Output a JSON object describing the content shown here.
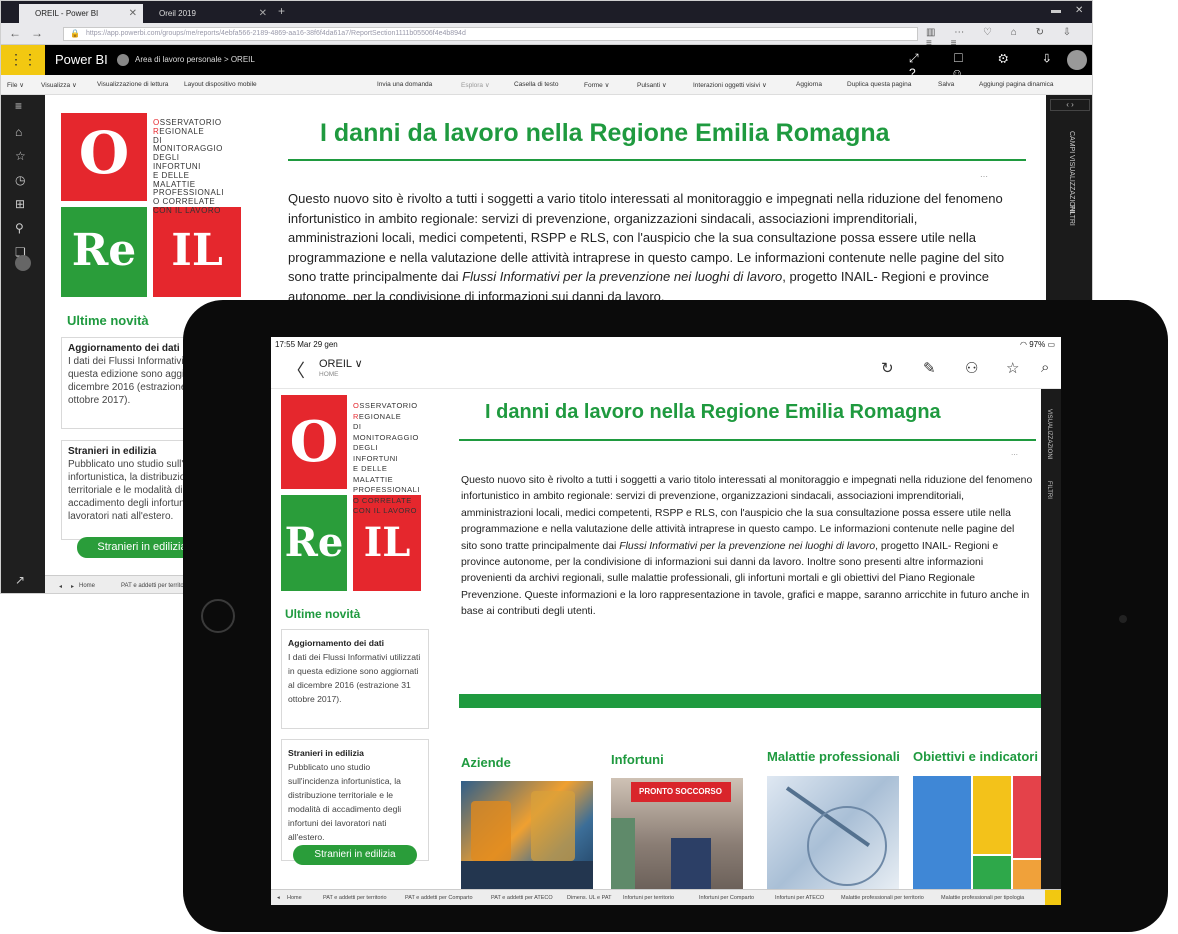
{
  "browser": {
    "tabs": [
      {
        "label": "OREIL - Power BI",
        "close": "✕"
      },
      {
        "label": "Oreil 2019",
        "close": "✕"
      }
    ],
    "new_tab": "+",
    "url": "https://app.powerbi.com/groups/me/reports/4ebfa566-2189-4869-aa16-38f6f4da61a7/ReportSection1111b05506f4e4b894d",
    "toolbar_icons": "▥ ⋯ ♡ ⌂ ↻ ⇩ ≡ ≡"
  },
  "powerbi": {
    "app_name": "Power BI",
    "breadcrumb": "Area di lavoro personale  >  OREIL",
    "header_icons": "⤢ ☐ ⚙ ⇩ ? ☺",
    "ribbon": {
      "file": "File ∨",
      "visualizza": "Visualizza ∨",
      "lettura": "Visualizzazione di lettura",
      "layout": "Layout dispositivo mobile",
      "domanda": "Invia una domanda",
      "esplora": "Esplora ∨",
      "casella": "Casella di testo",
      "forme": "Forme ∨",
      "pulsanti": "Pulsanti ∨",
      "interazioni": "Interazioni oggetti visivi ∨",
      "aggiorna": "Aggiorna",
      "duplica": "Duplica questa pagina",
      "salva": "Salva",
      "dinamica": "Aggiungi pagina dinamica"
    },
    "right_pane": {
      "campi": "CAMPI",
      "visualizzazioni": "VISUALIZZAZIONI",
      "filtri": "FILTRI"
    },
    "status_tabs": [
      "Home",
      "PAT e addetti per territorio"
    ]
  },
  "report": {
    "logo": {
      "o": "O",
      "re": "Re",
      "il": "IL",
      "lines": [
        "OSSERVATORIO",
        "REGIONALE",
        "DI MONITORAGGIO",
        "DEGLI INFORTUNI",
        "E DELLE MALATTIE",
        "PROFESSIONALI",
        "O CORRELATE",
        "CON IL LAVORO"
      ]
    },
    "title": "I danni da lavoro nella Regione Emilia Romagna",
    "intro_desktop": "Questo nuovo sito è rivolto a tutti i soggetti a vario titolo interessati al monitoraggio e impegnati nella riduzione del fenomeno infortunistico in ambito regionale: servizi di prevenzione, organizzazioni sindacali, associazioni imprenditoriali, amministrazioni locali, medici competenti, RSPP e RLS, con l'auspicio che la sua consultazione possa essere utile nella programmazione e nella valutazione delle attività intraprese in questo campo. Le informazioni contenute nelle pagine del sito sono tratte principalmente dai",
    "intro_italic": "Flussi Informativi per la prevenzione nei luoghi di lavoro",
    "intro_tail": ", progetto INAIL- Regioni e province autonome, per la condivisione di informazioni sui danni da lavoro.",
    "intro_more": "Inoltre sono presenti altre informazioni provenienti da archivi regionali, sulle malattie professionali, gli infortuni mortali e gli obiettivi del Piano Regionale Prevenzione. Queste informazioni e la loro rappresentazione in tavole, grafici e mappe, saranno arricchite in futuro anche in base ai contributi degli utenti.",
    "news_heading": "Ultime novità",
    "news": [
      {
        "title": "Aggiornamento dei dati",
        "body": "I dati dei Flussi Informativi utilizzati in questa edizione sono aggiornati al dicembre 2016 (estrazione 31 ottobre 2017)."
      },
      {
        "title": "Stranieri in edilizia",
        "body": "Pubblicato uno studio sull'incidenza infortunistica, la distribuzione territoriale e le modalità di accadimento degli infortuni dei lavoratori nati all'estero."
      }
    ],
    "news_button": "Stranieri in edilizia",
    "tiles": [
      "Aziende",
      "Infortuni",
      "Malattie professionali",
      "Obiettivi e indicatori"
    ],
    "pronto_soccorso": "PRONTO SOCCORSO",
    "dots": "⋯"
  },
  "ipad": {
    "time": "17:55  Mar 29 gen",
    "battery": "97%",
    "nav_title": "OREIL ∨",
    "nav_sub": "HOME",
    "back": "〈",
    "actions": [
      "↻",
      "✎",
      "⚇",
      "☆",
      "⌕"
    ],
    "status_tabs": [
      "Home",
      "PAT e addetti per territorio",
      "PAT e addetti per Comparto",
      "PAT e addetti per ATECO",
      "Dimens. UL e PAT",
      "Infortuni per territorio",
      "Infortuni per Comparto",
      "Infortuni per ATECO",
      "Malattie professionali per territorio",
      "Malattie professionali per tipologia"
    ],
    "right_pane": {
      "visualizzazioni": "VISUALIZZAZIONI",
      "filtri": "FILTRI"
    }
  }
}
